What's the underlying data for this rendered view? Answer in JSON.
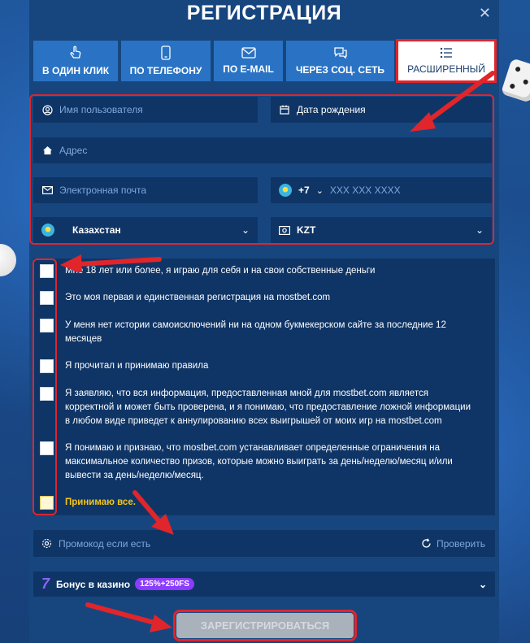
{
  "modal": {
    "title": "РЕГИСТРАЦИЯ",
    "close_label": "✕"
  },
  "tabs": [
    {
      "label": "В ОДИН КЛИК",
      "icon": "hand-pointer-icon",
      "active": false
    },
    {
      "label": "ПО ТЕЛЕФОНУ",
      "icon": "phone-icon",
      "active": false
    },
    {
      "label": "ПО E-MAIL",
      "icon": "mail-icon",
      "active": false
    },
    {
      "label": "ЧЕРЕЗ СОЦ. СЕТЬ",
      "icon": "chat-icon",
      "active": false
    },
    {
      "label": "РАСШИРЕННЫЙ",
      "icon": "list-icon",
      "active": true
    }
  ],
  "form": {
    "username_placeholder": "Имя пользователя",
    "birthdate_placeholder": "Дата рождения",
    "address_placeholder": "Адрес",
    "email_placeholder": "Электронная почта",
    "phone_code": "+7",
    "phone_placeholder": "XXX XXX XXXX",
    "country_value": "Казахстан",
    "currency_value": "KZT"
  },
  "checkboxes": [
    {
      "text": "Мне 18 лет или более, я играю для себя и на свои собственные деньги"
    },
    {
      "text": "Это моя первая и единственная регистрация на mostbet.com"
    },
    {
      "text": "У меня нет истории самоисключений ни на одном букмекерском сайте за последние 12 месяцев"
    },
    {
      "text": "Я прочитал и принимаю правила"
    },
    {
      "text": "Я заявляю, что вся информация, предоставленная мной для mostbet.com является корректной и может быть проверена, и я понимаю, что предоставление ложной информации в любом виде приведет к аннулированию всех выигрышей от моих игр на mostbet.com"
    },
    {
      "text": "Я понимаю и признаю, что mostbet.com устанавливает определенные ограничения на максимальное количество призов, которые можно выиграть за день/неделю/месяц и/или вывести за день/неделю/месяц."
    }
  ],
  "accept_all": "Принимаю все.",
  "promo": {
    "placeholder": "Промокод если есть",
    "verify_label": "Проверить"
  },
  "bonus": {
    "label": "Бонус в казино",
    "badge": "125%+250FS"
  },
  "submit_label": "ЗАРЕГИСТРИРОВАТЬСЯ",
  "colors": {
    "accent_red": "#e0252b",
    "tab_blue": "#2a73c4",
    "field_bg": "#0f3566",
    "accept_gold": "#f5c518",
    "badge_purple": "#8b3cff"
  }
}
